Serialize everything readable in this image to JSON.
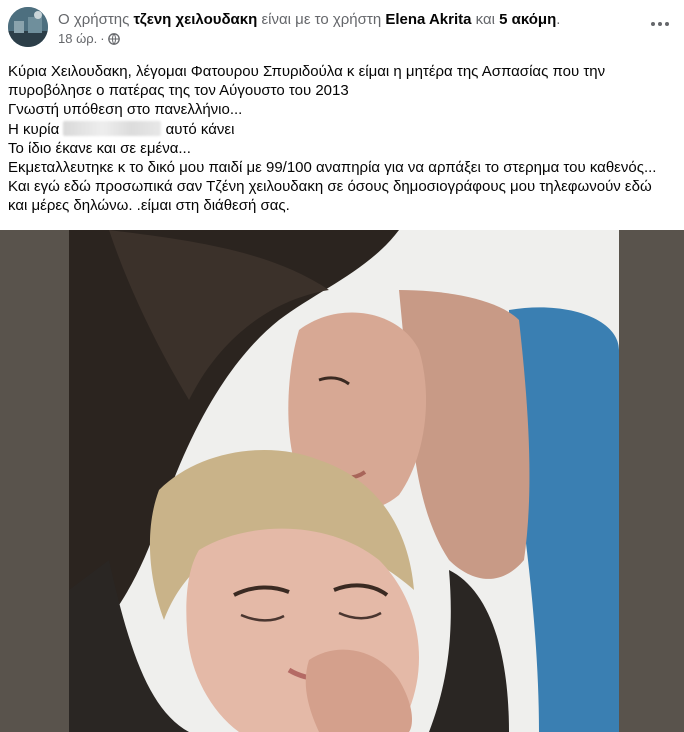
{
  "header": {
    "prefix": "Ο χρήστης",
    "author": "τζενη χειλουδακη",
    "middle": "είναι με το χρήστη",
    "tagged": "Elena Akrita",
    "joiner": "και",
    "others": "5 ακόμη",
    "suffix": ".",
    "timestamp": "18 ώρ.",
    "separator": "·",
    "privacy_icon": "globe-icon",
    "more_icon": "more-horizontal-icon"
  },
  "post": {
    "line1": "Κύρια Χειλουδακη, λέγομαι Φατουρου Σπυριδούλα κ είμαι η μητέρα της Ασπασίας που την",
    "line2": "πυροβόλησε ο πατέρας της τον Αύγουστο του 2013",
    "line3": "Γνωστή υπόθεση στο πανελλήνιο...",
    "line4_before": "Η κυρία",
    "line4_after": "αυτό κάνει",
    "line5": "Το ίδιο έκανε και σε εμένα...",
    "line6": "Εκμεταλλευτηκε κ το δικό μου παιδί με 99/100 αναπηρία για να αρπάξει το στερημα του καθενός...",
    "line7": "Και εγώ εδώ προσωπικά σαν Τζένη χειλουδακη σε όσους δημοσιογράφους μου τηλεφωνούν εδώ",
    "line8": "και μέρες δηλώνω.    .είμαι στη διάθεσή σας."
  },
  "colors": {
    "name_text": "#050505",
    "secondary_text": "#65676b",
    "media_background": "#59534c"
  }
}
